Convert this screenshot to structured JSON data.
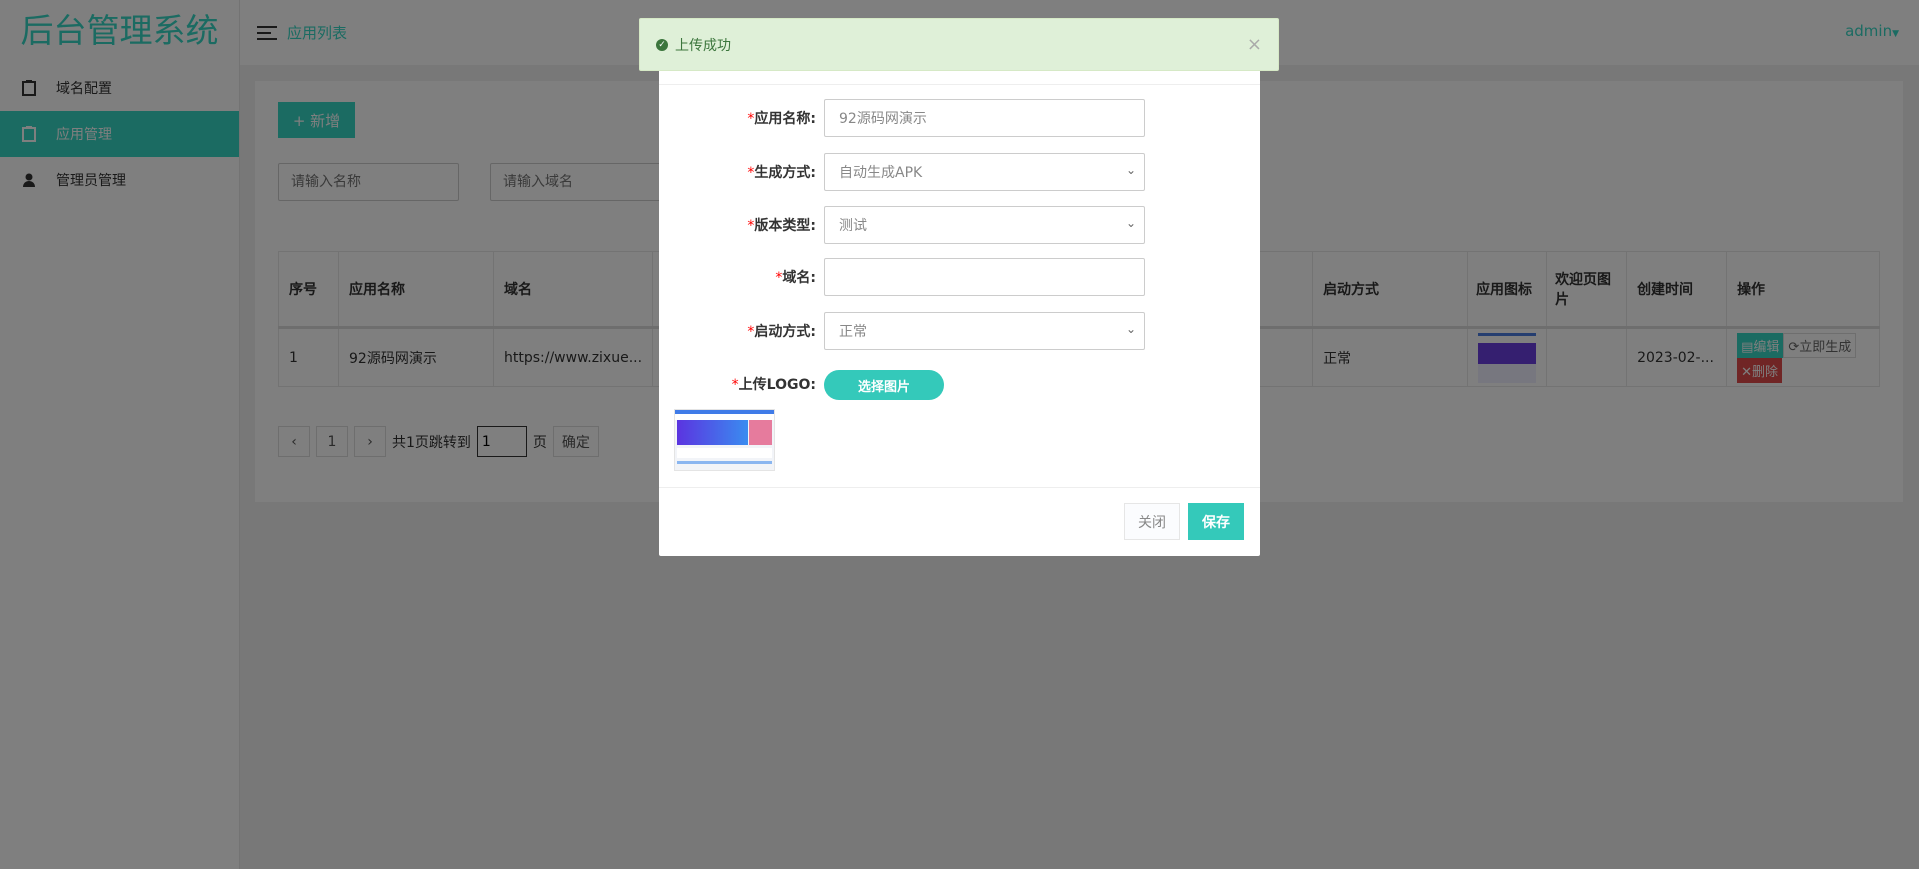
{
  "sidebar": {
    "title": "后台管理系统",
    "items": [
      {
        "label": "域名配置"
      },
      {
        "label": "应用管理"
      },
      {
        "label": "管理员管理"
      }
    ]
  },
  "header": {
    "crumb": "应用列表",
    "user": "admin"
  },
  "main": {
    "add_label": "+ 新增",
    "search_name_placeholder": "请输入名称",
    "search_domain_placeholder": "请输入域名",
    "columns": [
      "序号",
      "应用名称",
      "域名",
      "启动方式",
      "应用图标",
      "欢迎页图片",
      "创建时间",
      "操作"
    ],
    "rows": [
      {
        "index": "1",
        "name": "92源码网演示",
        "domain": "https://www.zixue...",
        "start": "正常",
        "created": "2023-02-..."
      }
    ],
    "actions": {
      "edit": "编辑",
      "generate": "立即生成",
      "delete": "删除"
    },
    "pager": {
      "prev": "‹",
      "page": "1",
      "next": "›",
      "total_text": "共1页跳转到",
      "jump_value": "1",
      "page_unit": "页",
      "confirm": "确定"
    }
  },
  "modal": {
    "fields": [
      {
        "label": "应用名称:",
        "value": "92源码网演示"
      },
      {
        "label": "生成方式:",
        "value": "自动生成APK"
      },
      {
        "label": "版本类型:",
        "value": "测试"
      },
      {
        "label": "域名:",
        "value": ""
      },
      {
        "label": "启动方式:",
        "value": "正常"
      },
      {
        "label": "上传LOGO:"
      }
    ],
    "required_mark": "*",
    "pick_label": "选择图片",
    "close_label": "关闭",
    "save_label": "保存"
  },
  "toast": {
    "message": "上传成功"
  },
  "colors": {
    "accent": "#36d6c4",
    "danger": "#e04b4b",
    "success_bg": "#dff0d8"
  }
}
